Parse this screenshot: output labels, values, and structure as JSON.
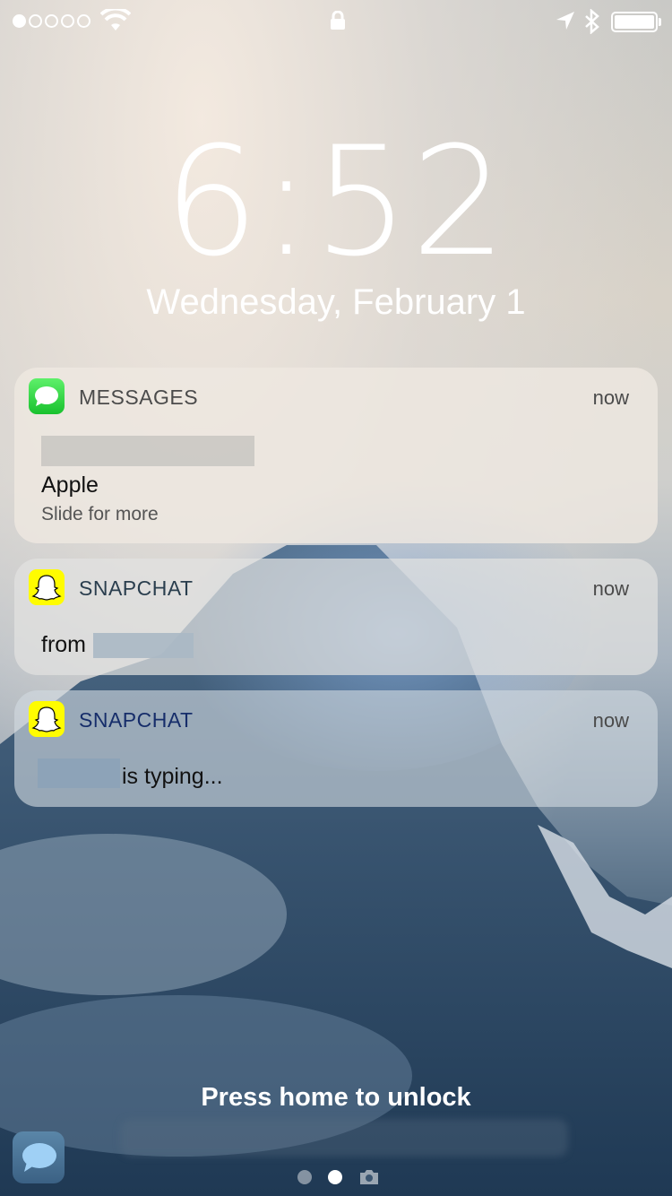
{
  "status_bar": {
    "signal_dots": 5,
    "signal_filled": 1,
    "icons": [
      "wifi-icon",
      "lock-icon",
      "location-arrow-icon",
      "bluetooth-icon",
      "battery-icon"
    ],
    "battery_level": 1.0
  },
  "lock_screen": {
    "time": "6:52",
    "date": "Wednesday, February 1",
    "unlock_hint": "Press home to unlock"
  },
  "notifications": [
    {
      "app": "MESSAGES",
      "app_icon": "messages-icon",
      "time": "now",
      "title": "Apple",
      "subtitle": "Slide for more",
      "accent": "#1fc531"
    },
    {
      "app": "SNAPCHAT",
      "app_icon": "snapchat-ghost-icon",
      "time": "now",
      "body": "from",
      "accent": "#fffc00"
    },
    {
      "app": "SNAPCHAT",
      "app_icon": "snapchat-ghost-icon",
      "time": "now",
      "body": "is typing...",
      "accent": "#fffc00"
    }
  ],
  "page_indicator": {
    "pages": 2,
    "active": 1,
    "trailing_icon": "camera-icon"
  }
}
